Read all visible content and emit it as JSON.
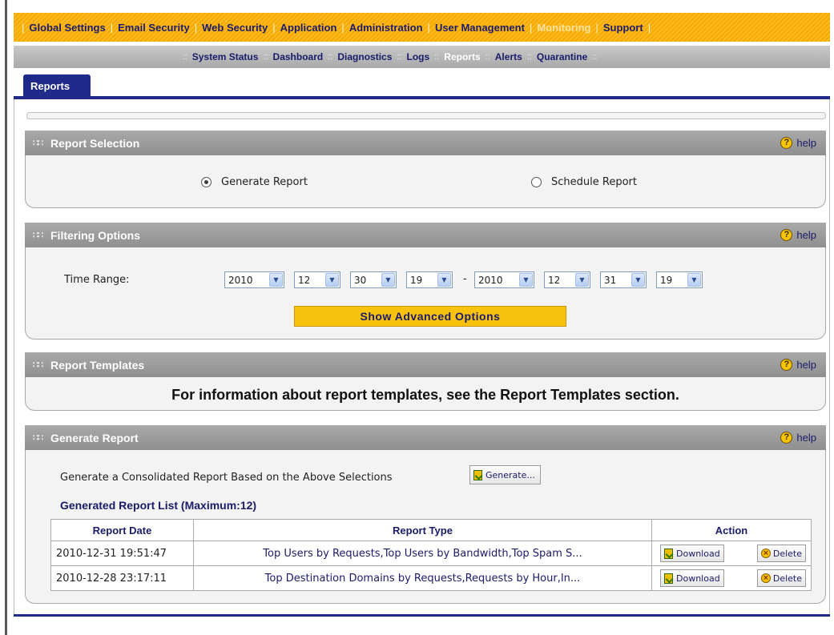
{
  "topnav": {
    "items": [
      {
        "label": "Global Settings",
        "active": false
      },
      {
        "label": "Email Security",
        "active": false
      },
      {
        "label": "Web Security",
        "active": false
      },
      {
        "label": "Application",
        "active": false
      },
      {
        "label": "Administration",
        "active": false
      },
      {
        "label": "User Management",
        "active": false
      },
      {
        "label": "Monitoring",
        "active": true
      },
      {
        "label": "Support",
        "active": false
      }
    ]
  },
  "subnav": {
    "items": [
      {
        "label": "System Status",
        "active": false
      },
      {
        "label": "Dashboard",
        "active": false
      },
      {
        "label": "Diagnostics",
        "active": false
      },
      {
        "label": "Logs",
        "active": false
      },
      {
        "label": "Reports",
        "active": true
      },
      {
        "label": "Alerts",
        "active": false
      },
      {
        "label": "Quarantine",
        "active": false
      }
    ]
  },
  "tab": {
    "label": "Reports"
  },
  "help_label": "help",
  "report_selection": {
    "title": "Report Selection",
    "generate_label": "Generate Report",
    "schedule_label": "Schedule Report",
    "selected": "generate"
  },
  "filtering": {
    "title": "Filtering Options",
    "time_range_label": "Time Range:",
    "start": {
      "year": "2010",
      "month": "12",
      "day": "30",
      "hour": "19"
    },
    "end": {
      "year": "2010",
      "month": "12",
      "day": "31",
      "hour": "19"
    },
    "separator": "-",
    "advanced_button": "Show Advanced Options"
  },
  "templates": {
    "title": "Report Templates",
    "note": "For information about report templates, see the Report Templates section."
  },
  "generate": {
    "title": "Generate Report",
    "description": "Generate a Consolidated Report Based on the Above Selections",
    "button": "Generate...",
    "list_title": "Generated Report List (Maximum:12)",
    "columns": [
      "Report Date",
      "Report Type",
      "Action"
    ],
    "rows": [
      {
        "date": "2010-12-31 19:51:47",
        "type": "Top Users by Requests,Top Users by Bandwidth,Top Spam S..."
      },
      {
        "date": "2010-12-28 23:17:11",
        "type": "Top Destination Domains by Requests,Requests by Hour,In..."
      }
    ],
    "download_label": "Download",
    "delete_label": "Delete"
  }
}
